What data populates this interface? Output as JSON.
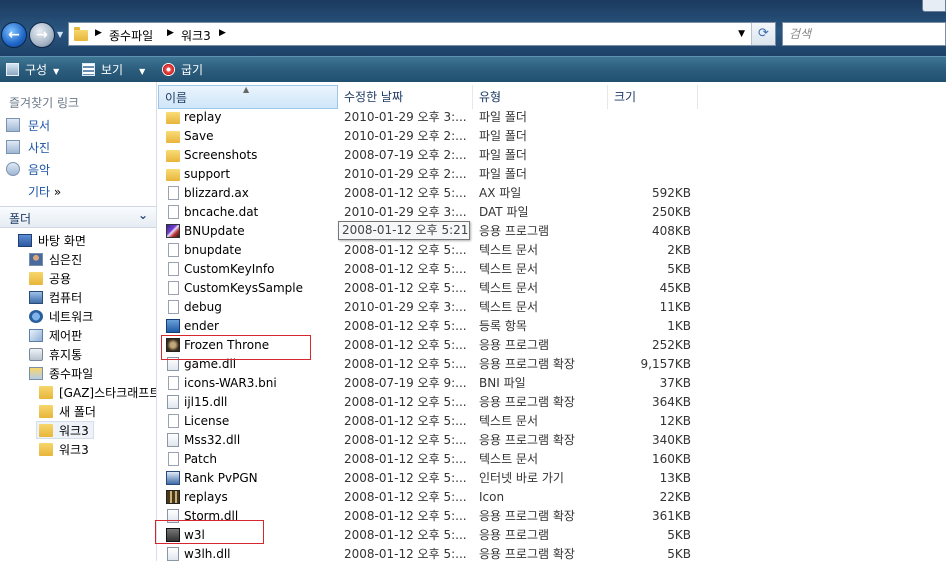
{
  "window": {
    "breadcrumb": [
      "종수파일",
      "워크3"
    ],
    "search_placeholder": "검색"
  },
  "toolbar": {
    "organize": "구성",
    "view": "보기",
    "burn": "굽기"
  },
  "nav": {
    "favorites_title": "즐겨찾기 링크",
    "favorites": [
      "문서",
      "사진",
      "음악"
    ],
    "more_label": "기타",
    "more_chevron": "»",
    "folders_title": "폴더",
    "tree": [
      "바탕 화면",
      "심은진",
      "공용",
      "컴퓨터",
      "네트워크",
      "제어판",
      "휴지통",
      "종수파일",
      "[GAZ]스타크래프트",
      "새 폴더",
      "워크3",
      "워크3"
    ]
  },
  "columns": {
    "name": "이름",
    "date": "수정한 날짜",
    "type": "유형",
    "size": "크기"
  },
  "files": [
    {
      "name": "replay",
      "date": "2010-01-29 오후 3:...",
      "type": "파일 폴더",
      "size": "",
      "icon": "folder"
    },
    {
      "name": "Save",
      "date": "2010-01-29 오후 2:...",
      "type": "파일 폴더",
      "size": "",
      "icon": "folder"
    },
    {
      "name": "Screenshots",
      "date": "2008-07-19 오후 2:...",
      "type": "파일 폴더",
      "size": "",
      "icon": "folder"
    },
    {
      "name": "support",
      "date": "2010-01-29 오후 2:...",
      "type": "파일 폴더",
      "size": "",
      "icon": "folder"
    },
    {
      "name": "blizzard.ax",
      "date": "2008-01-12 오후 5:...",
      "type": "AX 파일",
      "size": "592KB",
      "icon": "file"
    },
    {
      "name": "bncache.dat",
      "date": "2010-01-29 오후 3:...",
      "type": "DAT 파일",
      "size": "250KB",
      "icon": "file"
    },
    {
      "name": "BNUpdate",
      "date": "",
      "type": "응용 프로그램",
      "size": "408KB",
      "icon": "exe1"
    },
    {
      "name": "bnupdate",
      "date": "2008-01-12 오후 5:...",
      "type": "텍스트 문서",
      "size": "2KB",
      "icon": "file"
    },
    {
      "name": "CustomKeyInfo",
      "date": "2008-01-12 오후 5:...",
      "type": "텍스트 문서",
      "size": "5KB",
      "icon": "file"
    },
    {
      "name": "CustomKeysSample",
      "date": "2008-01-12 오후 5:...",
      "type": "텍스트 문서",
      "size": "45KB",
      "icon": "file"
    },
    {
      "name": "debug",
      "date": "2010-01-29 오후 3:...",
      "type": "텍스트 문서",
      "size": "11KB",
      "icon": "file"
    },
    {
      "name": "ender",
      "date": "2008-01-12 오후 5:...",
      "type": "등록 항목",
      "size": "1KB",
      "icon": "reg"
    },
    {
      "name": "Frozen Throne",
      "date": "2008-01-12 오후 5:...",
      "type": "응용 프로그램",
      "size": "252KB",
      "icon": "exe2"
    },
    {
      "name": "game.dll",
      "date": "2008-01-12 오후 5:...",
      "type": "응용 프로그램 확장",
      "size": "9,157KB",
      "icon": "dll"
    },
    {
      "name": "icons-WAR3.bni",
      "date": "2008-07-19 오후 9:...",
      "type": "BNI 파일",
      "size": "37KB",
      "icon": "file"
    },
    {
      "name": "ijl15.dll",
      "date": "2008-01-12 오후 5:...",
      "type": "응용 프로그램 확장",
      "size": "364KB",
      "icon": "dll"
    },
    {
      "name": "License",
      "date": "2008-01-12 오후 5:...",
      "type": "텍스트 문서",
      "size": "12KB",
      "icon": "file"
    },
    {
      "name": "Mss32.dll",
      "date": "2008-01-12 오후 5:...",
      "type": "응용 프로그램 확장",
      "size": "340KB",
      "icon": "dll"
    },
    {
      "name": "Patch",
      "date": "2008-01-12 오후 5:...",
      "type": "텍스트 문서",
      "size": "160KB",
      "icon": "file"
    },
    {
      "name": "Rank PvPGN",
      "date": "2008-01-12 오후 5:...",
      "type": "인터넷 바로 가기",
      "size": "13KB",
      "icon": "link"
    },
    {
      "name": "replays",
      "date": "2008-01-12 오후 5:...",
      "type": "Icon",
      "size": "22KB",
      "icon": "ico"
    },
    {
      "name": "Storm.dll",
      "date": "2008-01-12 오후 5:...",
      "type": "응용 프로그램 확장",
      "size": "361KB",
      "icon": "dll"
    },
    {
      "name": "w3l",
      "date": "2008-01-12 오후 5:...",
      "type": "응용 프로그램",
      "size": "5KB",
      "icon": "w3l"
    },
    {
      "name": "w3lh.dll",
      "date": "2008-01-12 오후 5:...",
      "type": "응용 프로그램 확장",
      "size": "5KB",
      "icon": "dll"
    }
  ],
  "tooltip": {
    "date_full": "2008-01-12 오후 5:21"
  },
  "colors": {
    "highlight_box": "#d6262e",
    "link_blue": "#1a53a6"
  }
}
